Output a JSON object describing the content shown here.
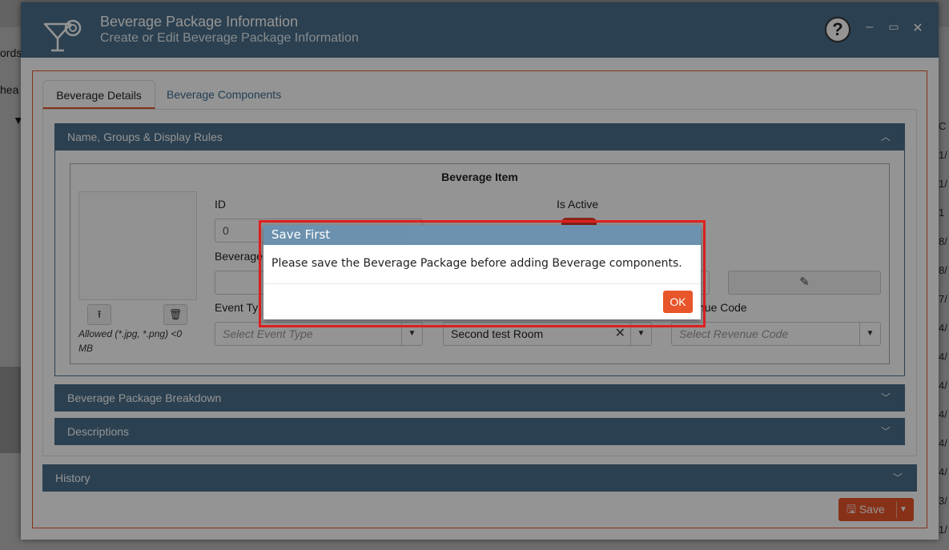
{
  "background": {
    "partial_text_1": "ords",
    "partial_text_2": "hea",
    "right_column": [
      "C",
      "1/",
      "1/",
      "1",
      "8/",
      "8/",
      "7/",
      "4/",
      "4/",
      "4/",
      "4/",
      "4/",
      "4/",
      "3/",
      "1/"
    ]
  },
  "window": {
    "title": "Beverage Package Information",
    "subtitle": "Create or Edit Beverage Package Information",
    "help": "?",
    "minimize": "–",
    "maximize": "▭",
    "close": "✕"
  },
  "tabs": [
    {
      "label": "Beverage Details",
      "active": true
    },
    {
      "label": "Beverage Components",
      "active": false
    }
  ],
  "panels": {
    "name_groups": "Name, Groups & Display Rules",
    "breakdown": "Beverage Package Breakdown",
    "descriptions": "Descriptions",
    "history": "History"
  },
  "beverage_item": {
    "title": "Beverage Item",
    "allowed_text": "Allowed (*.jpg, *.png) <0 MB",
    "id_label": "ID",
    "id_value": "0",
    "is_active_label": "Is Active",
    "beverage_label_partial": "Beverage",
    "event_type_label_partial": "Event Ty",
    "event_type_placeholder": "Select Event Type",
    "room_value": "Second test Room",
    "revenue_code_label_partial": "nue Code",
    "revenue_code_placeholder": "Select Revenue Code"
  },
  "save_button": {
    "label": "Save"
  },
  "dialog": {
    "title": "Save First",
    "message": "Please save the Beverage Package before adding Beverage components.",
    "ok_label": "OK"
  },
  "colors": {
    "header_blue": "#4a6f8a",
    "accent_orange": "#e8552a",
    "highlight_red": "#e02020"
  }
}
